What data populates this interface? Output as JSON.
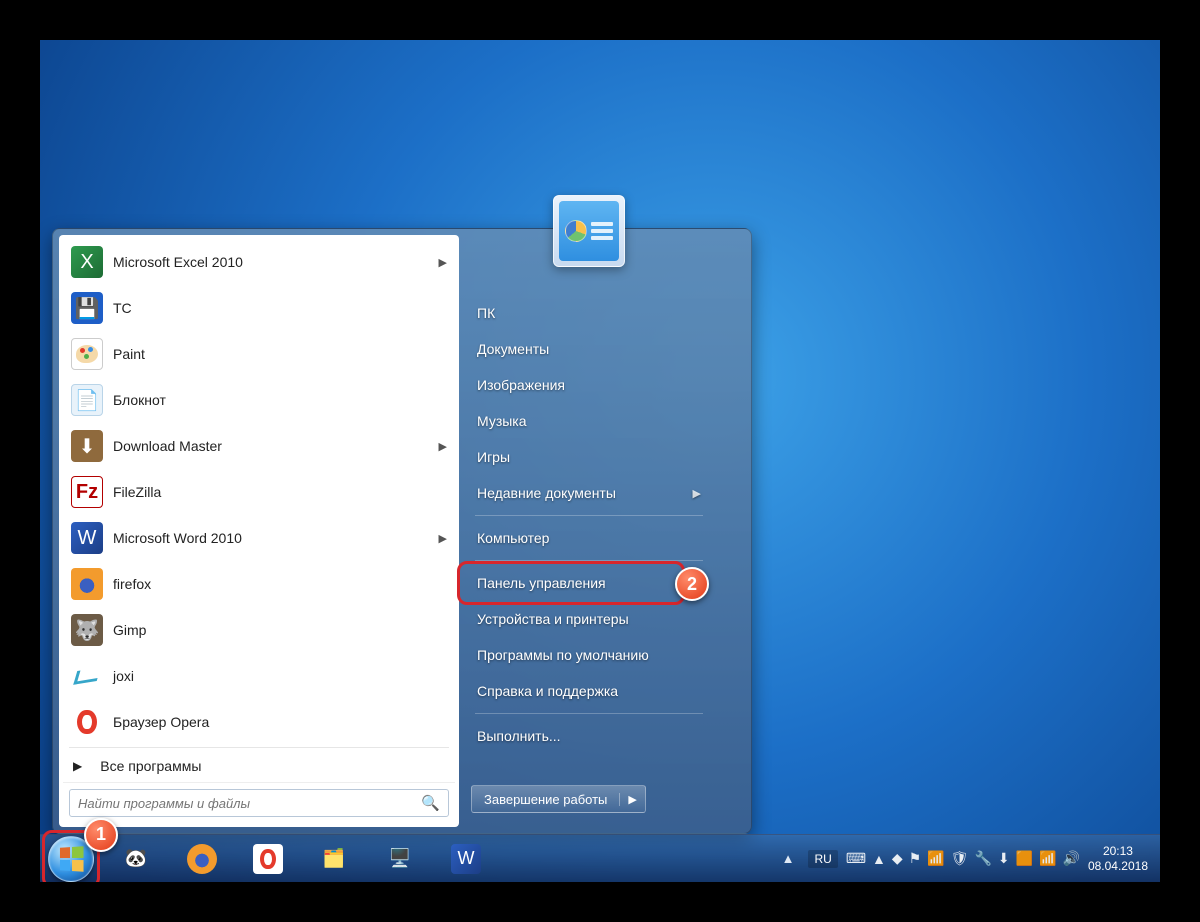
{
  "programs": [
    {
      "label": "Microsoft Excel 2010",
      "icon": "excel",
      "submenu": true
    },
    {
      "label": "TC",
      "icon": "tc",
      "submenu": false
    },
    {
      "label": "Paint",
      "icon": "paint",
      "submenu": false
    },
    {
      "label": "Блокнот",
      "icon": "notepad",
      "submenu": false
    },
    {
      "label": "Download Master",
      "icon": "dm",
      "submenu": true
    },
    {
      "label": "FileZilla",
      "icon": "filezilla",
      "submenu": false
    },
    {
      "label": "Microsoft Word 2010",
      "icon": "word",
      "submenu": true
    },
    {
      "label": "firefox",
      "icon": "firefox",
      "submenu": false
    },
    {
      "label": "Gimp",
      "icon": "gimp",
      "submenu": false
    },
    {
      "label": "joxi",
      "icon": "joxi",
      "submenu": false
    },
    {
      "label": "Браузер Opera",
      "icon": "opera",
      "submenu": false
    }
  ],
  "all_programs": "Все программы",
  "search": {
    "placeholder": "Найти программы и файлы"
  },
  "right_items": [
    {
      "label": "ПК",
      "submenu": false
    },
    {
      "label": "Документы",
      "submenu": false
    },
    {
      "label": "Изображения",
      "submenu": false
    },
    {
      "label": "Музыка",
      "submenu": false
    },
    {
      "label": "Игры",
      "submenu": false
    },
    {
      "label": "Недавние документы",
      "submenu": true,
      "sep_after": true
    },
    {
      "label": "Компьютер",
      "submenu": false,
      "sep_after": true
    },
    {
      "label": "Панель управления",
      "submenu": false,
      "highlight": true
    },
    {
      "label": "Устройства и принтеры",
      "submenu": false
    },
    {
      "label": "Программы по умолчанию",
      "submenu": false
    },
    {
      "label": "Справка и поддержка",
      "submenu": false,
      "sep_after": true
    },
    {
      "label": "Выполнить...",
      "submenu": false
    }
  ],
  "shutdown_label": "Завершение работы",
  "taskbar": {
    "pinned": [
      {
        "name": "panda",
        "glyph": "🐼"
      },
      {
        "name": "firefox",
        "glyph": "🦊"
      },
      {
        "name": "opera",
        "glyph": "⭕"
      },
      {
        "name": "explorer",
        "glyph": "🗂️"
      },
      {
        "name": "devices",
        "glyph": "🖥️"
      },
      {
        "name": "word",
        "glyph": "W"
      }
    ],
    "lang": "RU",
    "tray_icons": [
      "⌨",
      "▲",
      "◆",
      "⚑",
      "📶",
      "🛡",
      "🔧",
      "⬇",
      "🟧",
      "📶",
      "🔊"
    ],
    "time": "20:13",
    "date": "08.04.2018"
  },
  "annotations": {
    "a1": "1",
    "a2": "2"
  }
}
